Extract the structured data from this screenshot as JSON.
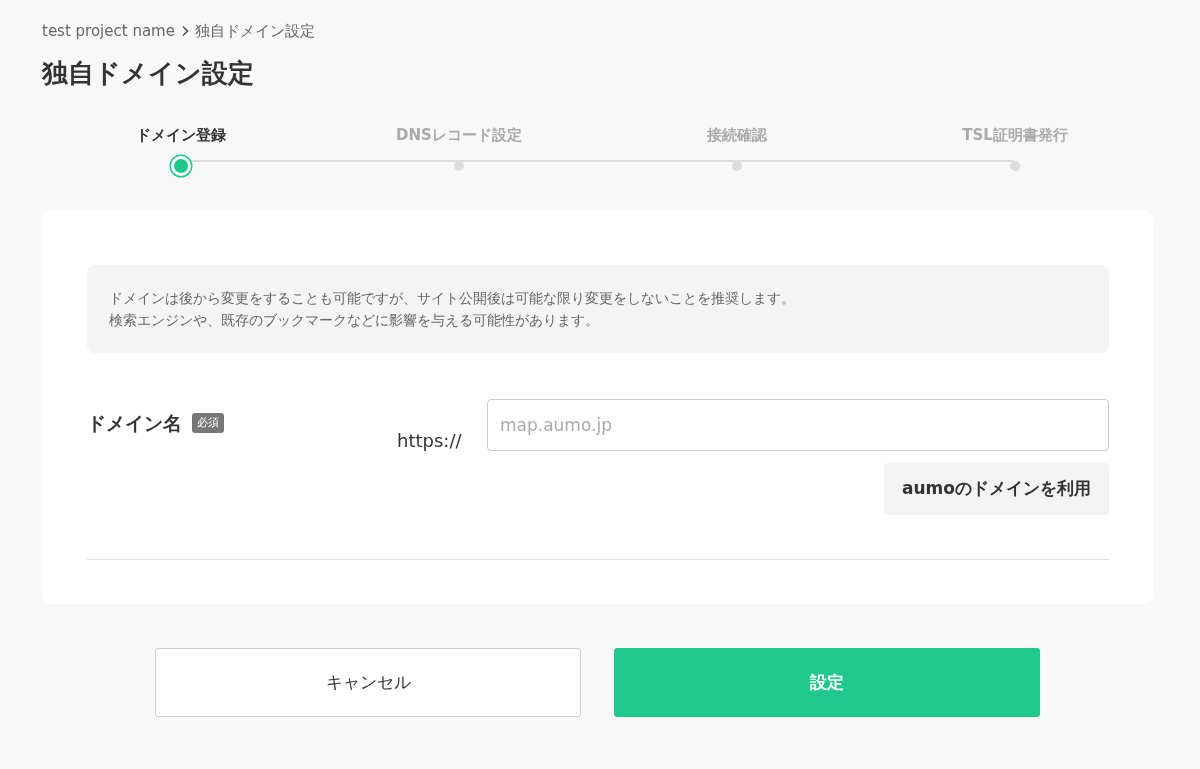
{
  "breadcrumb": [
    "test project name",
    "独自ドメイン設定"
  ],
  "title": "独自ドメイン設定",
  "steps": [
    {
      "label": "ドメイン登録",
      "selected": true
    },
    {
      "label": "DNSレコード設定",
      "selected": false
    },
    {
      "label": "接続確認",
      "selected": false
    },
    {
      "label": "TSL証明書発行",
      "selected": false
    }
  ],
  "notice": [
    "ドメインは後から変更をすることも可能ですが、サイト公開後は可能な限り変更をしないことを推奨します。",
    "検索エンジンや、既存のブックマークなどに影響を与える可能性があります。"
  ],
  "field": {
    "label": "ドメイン名",
    "badge": "必須",
    "prefix": "https://",
    "placeholder": "map.aumo.jp",
    "button": "aumoのドメインを利用"
  },
  "buttons": [
    {
      "kind": "cancel",
      "label": "キャンセル"
    },
    {
      "kind": "submit",
      "label": "設定"
    }
  ]
}
